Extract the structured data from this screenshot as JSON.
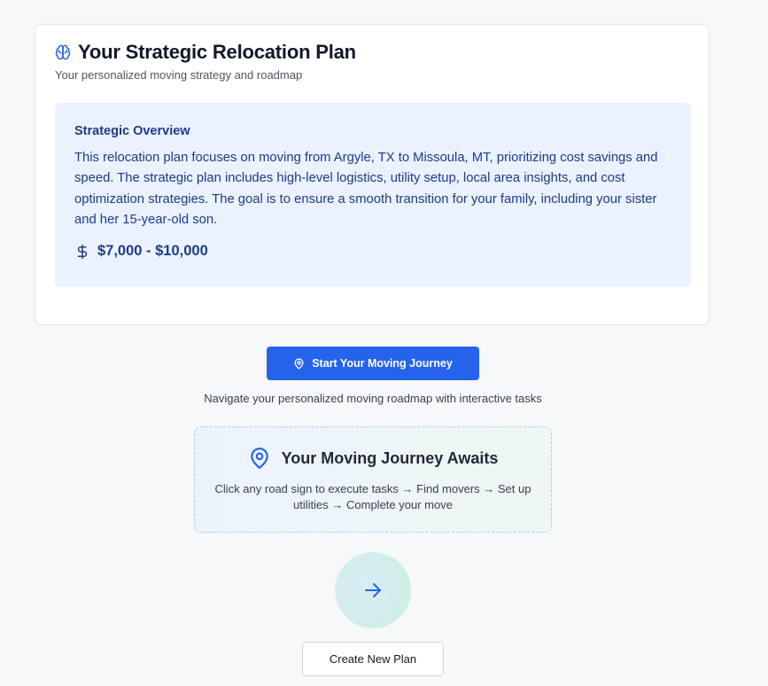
{
  "plan": {
    "title": "Your Strategic Relocation Plan",
    "subtitle": "Your personalized moving strategy and roadmap",
    "title_icon": "brain-icon"
  },
  "overview": {
    "heading": "Strategic Overview",
    "text": "This relocation plan focuses on moving from Argyle, TX to Missoula, MT, prioritizing cost savings and speed. The strategic plan includes high-level logistics, utility setup, local area insights, and cost optimization strategies. The goal is to ensure a smooth transition for your family, including your sister and her 15-year-old son.",
    "budget_icon": "dollar-icon",
    "budget": "$7,000 - $10,000"
  },
  "journey": {
    "start_button_label": "Start Your Moving Journey",
    "start_button_icon": "map-pin-icon",
    "note": "Navigate your personalized moving roadmap with interactive tasks",
    "box_icon": "map-pin-icon",
    "box_title": "Your Moving Journey Awaits",
    "box_description": "Click any road sign to execute tasks → Find movers → Set up utilities → Complete your move",
    "next_icon": "arrow-right-icon"
  },
  "actions": {
    "create_plan_label": "Create New Plan"
  },
  "colors": {
    "accent": "#2563eb",
    "overview_bg": "#eaf2fe",
    "overview_text": "#1e3a8a",
    "page_bg": "#f7f8fa"
  }
}
